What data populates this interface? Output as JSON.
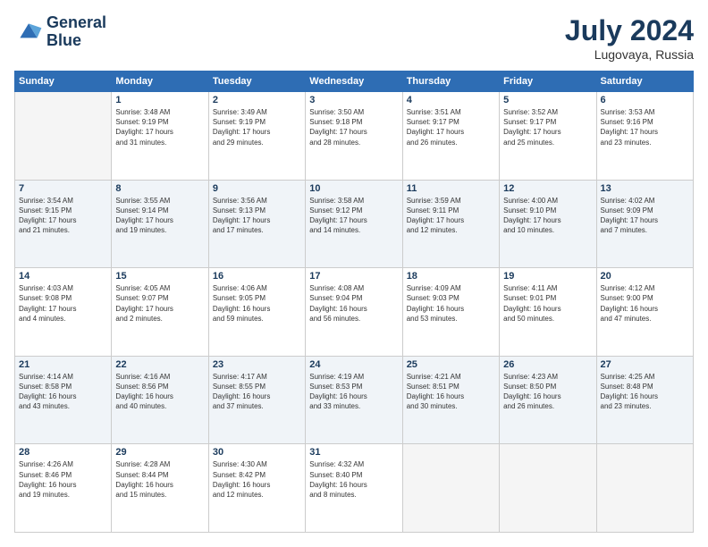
{
  "header": {
    "logo_line1": "General",
    "logo_line2": "Blue",
    "month": "July 2024",
    "location": "Lugovaya, Russia"
  },
  "weekdays": [
    "Sunday",
    "Monday",
    "Tuesday",
    "Wednesday",
    "Thursday",
    "Friday",
    "Saturday"
  ],
  "weeks": [
    [
      {
        "day": "",
        "info": ""
      },
      {
        "day": "1",
        "info": "Sunrise: 3:48 AM\nSunset: 9:19 PM\nDaylight: 17 hours\nand 31 minutes."
      },
      {
        "day": "2",
        "info": "Sunrise: 3:49 AM\nSunset: 9:19 PM\nDaylight: 17 hours\nand 29 minutes."
      },
      {
        "day": "3",
        "info": "Sunrise: 3:50 AM\nSunset: 9:18 PM\nDaylight: 17 hours\nand 28 minutes."
      },
      {
        "day": "4",
        "info": "Sunrise: 3:51 AM\nSunset: 9:17 PM\nDaylight: 17 hours\nand 26 minutes."
      },
      {
        "day": "5",
        "info": "Sunrise: 3:52 AM\nSunset: 9:17 PM\nDaylight: 17 hours\nand 25 minutes."
      },
      {
        "day": "6",
        "info": "Sunrise: 3:53 AM\nSunset: 9:16 PM\nDaylight: 17 hours\nand 23 minutes."
      }
    ],
    [
      {
        "day": "7",
        "info": "Sunrise: 3:54 AM\nSunset: 9:15 PM\nDaylight: 17 hours\nand 21 minutes."
      },
      {
        "day": "8",
        "info": "Sunrise: 3:55 AM\nSunset: 9:14 PM\nDaylight: 17 hours\nand 19 minutes."
      },
      {
        "day": "9",
        "info": "Sunrise: 3:56 AM\nSunset: 9:13 PM\nDaylight: 17 hours\nand 17 minutes."
      },
      {
        "day": "10",
        "info": "Sunrise: 3:58 AM\nSunset: 9:12 PM\nDaylight: 17 hours\nand 14 minutes."
      },
      {
        "day": "11",
        "info": "Sunrise: 3:59 AM\nSunset: 9:11 PM\nDaylight: 17 hours\nand 12 minutes."
      },
      {
        "day": "12",
        "info": "Sunrise: 4:00 AM\nSunset: 9:10 PM\nDaylight: 17 hours\nand 10 minutes."
      },
      {
        "day": "13",
        "info": "Sunrise: 4:02 AM\nSunset: 9:09 PM\nDaylight: 17 hours\nand 7 minutes."
      }
    ],
    [
      {
        "day": "14",
        "info": "Sunrise: 4:03 AM\nSunset: 9:08 PM\nDaylight: 17 hours\nand 4 minutes."
      },
      {
        "day": "15",
        "info": "Sunrise: 4:05 AM\nSunset: 9:07 PM\nDaylight: 17 hours\nand 2 minutes."
      },
      {
        "day": "16",
        "info": "Sunrise: 4:06 AM\nSunset: 9:05 PM\nDaylight: 16 hours\nand 59 minutes."
      },
      {
        "day": "17",
        "info": "Sunrise: 4:08 AM\nSunset: 9:04 PM\nDaylight: 16 hours\nand 56 minutes."
      },
      {
        "day": "18",
        "info": "Sunrise: 4:09 AM\nSunset: 9:03 PM\nDaylight: 16 hours\nand 53 minutes."
      },
      {
        "day": "19",
        "info": "Sunrise: 4:11 AM\nSunset: 9:01 PM\nDaylight: 16 hours\nand 50 minutes."
      },
      {
        "day": "20",
        "info": "Sunrise: 4:12 AM\nSunset: 9:00 PM\nDaylight: 16 hours\nand 47 minutes."
      }
    ],
    [
      {
        "day": "21",
        "info": "Sunrise: 4:14 AM\nSunset: 8:58 PM\nDaylight: 16 hours\nand 43 minutes."
      },
      {
        "day": "22",
        "info": "Sunrise: 4:16 AM\nSunset: 8:56 PM\nDaylight: 16 hours\nand 40 minutes."
      },
      {
        "day": "23",
        "info": "Sunrise: 4:17 AM\nSunset: 8:55 PM\nDaylight: 16 hours\nand 37 minutes."
      },
      {
        "day": "24",
        "info": "Sunrise: 4:19 AM\nSunset: 8:53 PM\nDaylight: 16 hours\nand 33 minutes."
      },
      {
        "day": "25",
        "info": "Sunrise: 4:21 AM\nSunset: 8:51 PM\nDaylight: 16 hours\nand 30 minutes."
      },
      {
        "day": "26",
        "info": "Sunrise: 4:23 AM\nSunset: 8:50 PM\nDaylight: 16 hours\nand 26 minutes."
      },
      {
        "day": "27",
        "info": "Sunrise: 4:25 AM\nSunset: 8:48 PM\nDaylight: 16 hours\nand 23 minutes."
      }
    ],
    [
      {
        "day": "28",
        "info": "Sunrise: 4:26 AM\nSunset: 8:46 PM\nDaylight: 16 hours\nand 19 minutes."
      },
      {
        "day": "29",
        "info": "Sunrise: 4:28 AM\nSunset: 8:44 PM\nDaylight: 16 hours\nand 15 minutes."
      },
      {
        "day": "30",
        "info": "Sunrise: 4:30 AM\nSunset: 8:42 PM\nDaylight: 16 hours\nand 12 minutes."
      },
      {
        "day": "31",
        "info": "Sunrise: 4:32 AM\nSunset: 8:40 PM\nDaylight: 16 hours\nand 8 minutes."
      },
      {
        "day": "",
        "info": ""
      },
      {
        "day": "",
        "info": ""
      },
      {
        "day": "",
        "info": ""
      }
    ]
  ]
}
